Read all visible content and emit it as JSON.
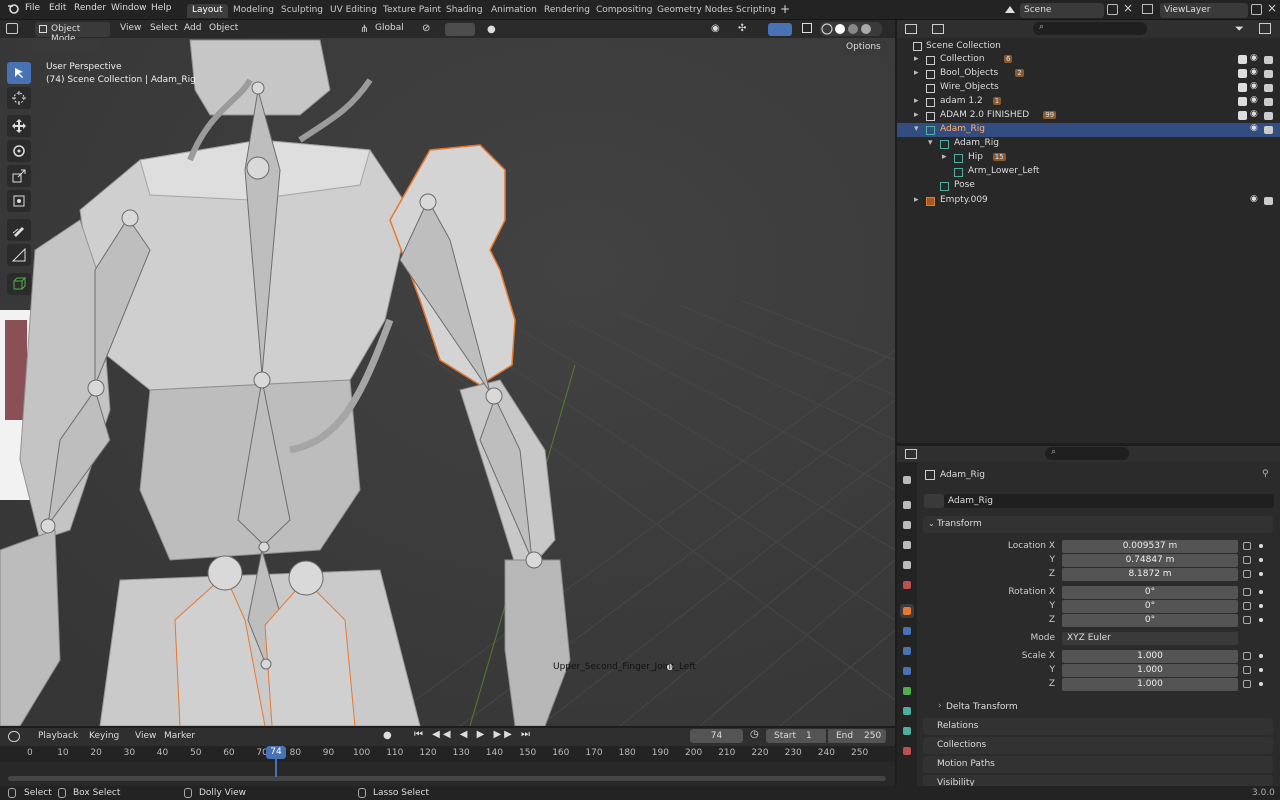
{
  "menus": [
    "File",
    "Edit",
    "Render",
    "Window",
    "Help"
  ],
  "workspaces": [
    "Layout",
    "Modeling",
    "Sculpting",
    "UV Editing",
    "Texture Paint",
    "Shading",
    "Animation",
    "Rendering",
    "Compositing",
    "Geometry Nodes",
    "Scripting"
  ],
  "active_workspace": "Layout",
  "scene_name": "Scene",
  "view_layer": "ViewLayer",
  "viewport": {
    "mode": "Object Mode",
    "menus": [
      "View",
      "Select",
      "Add",
      "Object"
    ],
    "orientation": "Global",
    "options_label": "Options",
    "info_line1": "User Perspective",
    "info_line2": "(74) Scene Collection | Adam_Rig",
    "bone_label": "Upper_Second_Finger_Joint_Left"
  },
  "outliner": {
    "root": "Scene Collection",
    "items": [
      {
        "label": "Collection",
        "badge": "6"
      },
      {
        "label": "Bool_Objects",
        "badge": "2"
      },
      {
        "label": "Wire_Objects",
        "badge": ""
      },
      {
        "label": "adam 1.2",
        "badge": "1"
      },
      {
        "label": "ADAM 2.0 FINISHED",
        "badge": "99"
      },
      {
        "label": "Adam_Rig",
        "badge": ""
      },
      {
        "label": "Adam_Rig",
        "badge": ""
      },
      {
        "label": "Hip",
        "badge": "15"
      },
      {
        "label": "Arm_Lower_Left",
        "badge": ""
      },
      {
        "label": "Pose",
        "badge": ""
      },
      {
        "label": "Empty.009",
        "badge": ""
      }
    ]
  },
  "properties": {
    "object_name": "Adam_Rig",
    "data_name": "Adam_Rig",
    "transform_label": "Transform",
    "location_label": "Location X",
    "location": [
      "0.009537 m",
      "0.74847 m",
      "8.1872 m"
    ],
    "rotation_label": "Rotation X",
    "rotation": [
      "0°",
      "0°",
      "0°"
    ],
    "mode_label": "Mode",
    "mode_value": "XYZ Euler",
    "scale_label": "Scale X",
    "scale": [
      "1.000",
      "1.000",
      "1.000"
    ],
    "y_label": "Y",
    "z_label": "Z",
    "sections": [
      "Delta Transform",
      "Relations",
      "Collections",
      "Motion Paths",
      "Visibility"
    ]
  },
  "timeline": {
    "menus": [
      "Playback",
      "Keying",
      "View",
      "Marker"
    ],
    "current_frame": "74",
    "start_label": "Start",
    "start": "1",
    "end_label": "End",
    "end": "250",
    "ticks": [
      "0",
      "10",
      "20",
      "30",
      "40",
      "50",
      "60",
      "70",
      "80",
      "90",
      "100",
      "110",
      "120",
      "130",
      "140",
      "150",
      "160",
      "170",
      "180",
      "190",
      "200",
      "210",
      "220",
      "230",
      "240",
      "250"
    ]
  },
  "status": {
    "select": "Select",
    "box_select": "Box Select",
    "dolly": "Dolly View",
    "lasso": "Lasso Select",
    "version": "3.0.0"
  },
  "colors": {
    "accent": "#4772b3",
    "selection": "#e9782f",
    "outliner_sel": "#334d80"
  }
}
